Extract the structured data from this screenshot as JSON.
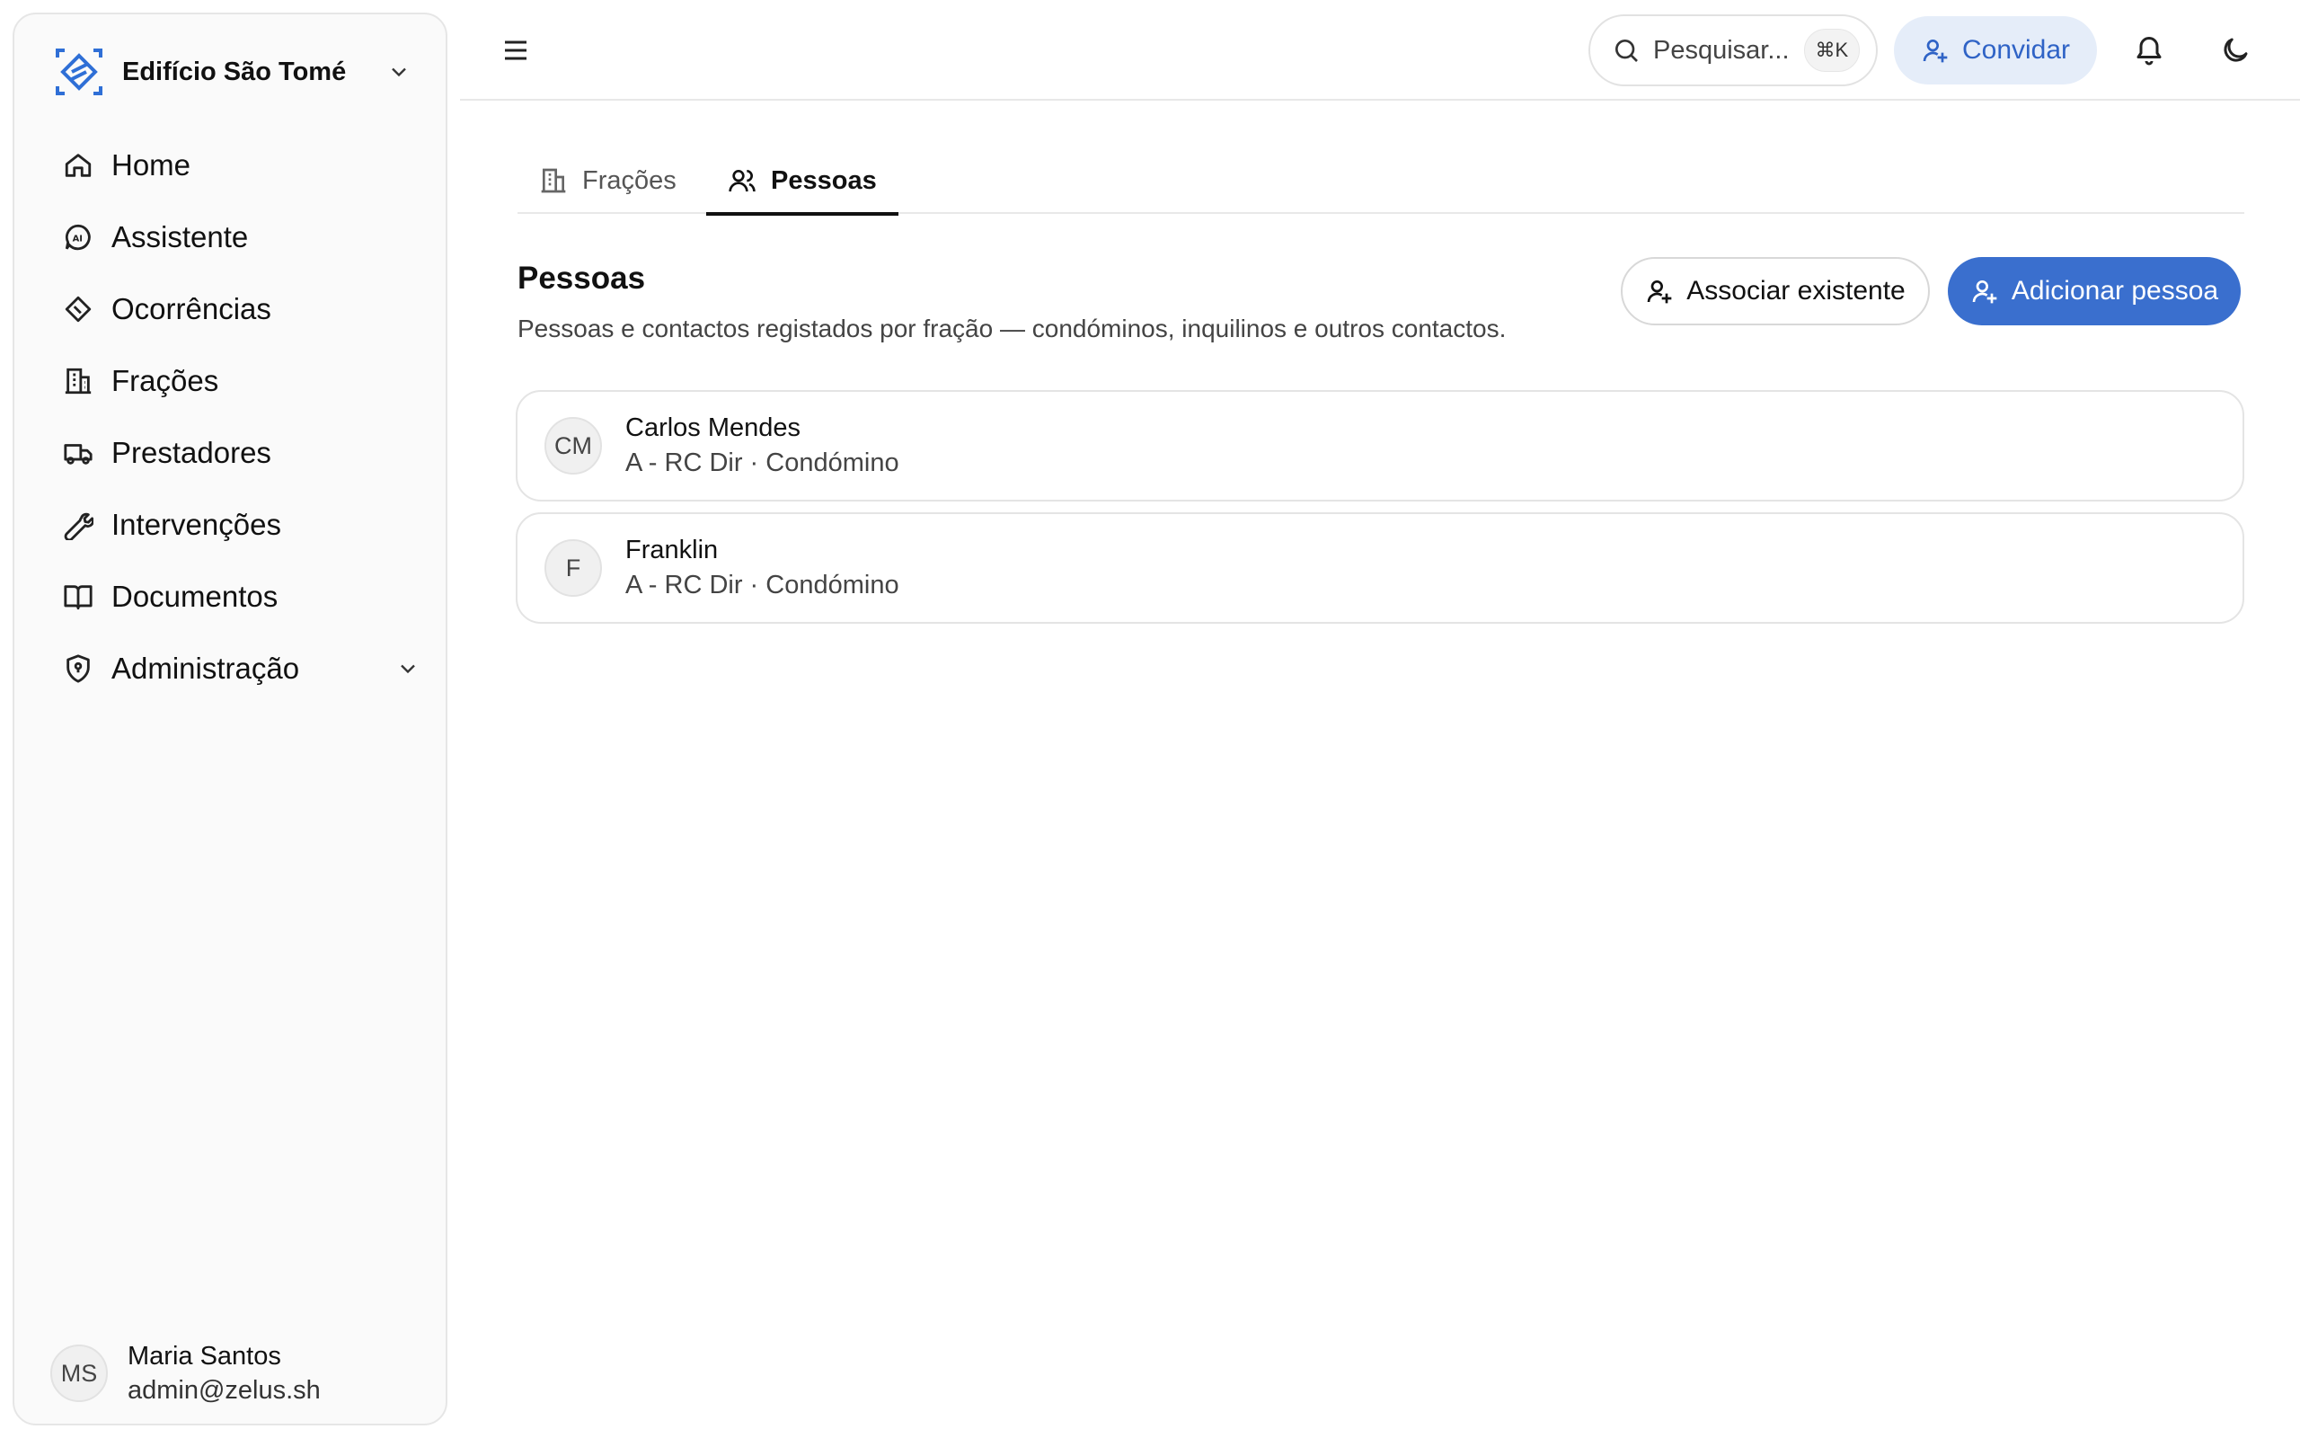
{
  "workspace": {
    "name": "Edifício São Tomé"
  },
  "sidebar": {
    "items": [
      {
        "label": "Home"
      },
      {
        "label": "Assistente"
      },
      {
        "label": "Ocorrências"
      },
      {
        "label": "Frações"
      },
      {
        "label": "Prestadores"
      },
      {
        "label": "Intervenções"
      },
      {
        "label": "Documentos"
      },
      {
        "label": "Administração"
      }
    ],
    "user": {
      "initials": "MS",
      "name": "Maria Santos",
      "email": "admin@zelus.sh"
    }
  },
  "topbar": {
    "search_placeholder": "Pesquisar...",
    "search_shortcut": "⌘K",
    "invite_label": "Convidar"
  },
  "tabs": [
    {
      "label": "Frações",
      "active": false
    },
    {
      "label": "Pessoas",
      "active": true
    }
  ],
  "section": {
    "title": "Pessoas",
    "description": "Pessoas e contactos registados por fração — condóminos, inquilinos e outros contactos.",
    "associate_label": "Associar existente",
    "add_label": "Adicionar pessoa"
  },
  "people": [
    {
      "initials": "CM",
      "name": "Carlos Mendes",
      "meta": "A - RC Dir · Condómino"
    },
    {
      "initials": "F",
      "name": "Franklin",
      "meta": "A - RC Dir · Condómino"
    }
  ],
  "colors": {
    "accent": "#3a6fce",
    "accent_soft": "#e5edf9",
    "logo": "#2f6fd6"
  }
}
